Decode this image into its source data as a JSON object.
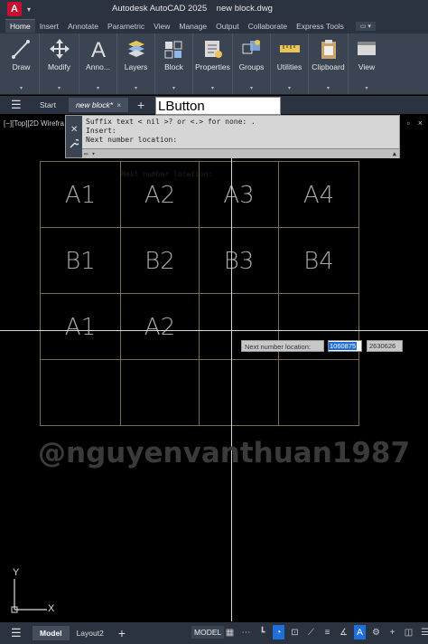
{
  "titlebar": {
    "app_icon": "A",
    "caret": "▾",
    "title": "Autodesk AutoCAD 2025    new block.dwg"
  },
  "ribbon_tabs": [
    "Home",
    "Insert",
    "Annotate",
    "Parametric",
    "View",
    "Manage",
    "Output",
    "Collaborate",
    "Express Tools"
  ],
  "ribbon_extra": "▭ ▾",
  "panels": [
    {
      "label": "Draw",
      "icon": "pencil-line-icon"
    },
    {
      "label": "Modify",
      "icon": "move-arrows-icon"
    },
    {
      "label": "Anno...",
      "icon": "text-a-icon"
    },
    {
      "label": "Layers",
      "icon": "layers-icon"
    },
    {
      "label": "Block",
      "icon": "block-icon"
    },
    {
      "label": "Properties",
      "icon": "properties-icon"
    },
    {
      "label": "Groups",
      "icon": "groups-icon"
    },
    {
      "label": "Utilities",
      "icon": "ruler-icon"
    },
    {
      "label": "Clipboard",
      "icon": "clipboard-icon"
    },
    {
      "label": "View",
      "icon": "view-icon"
    }
  ],
  "filetabs": {
    "start": "Start",
    "active": "new block*",
    "close": "×",
    "plus": "+"
  },
  "lbutton_text": "LButton",
  "viewport": {
    "label": "[−][Top][2D Wirefra",
    "controls": [
      "−",
      "▫",
      "×"
    ]
  },
  "command": {
    "history": [
      "Suffix text < nil >? or <.> for none: .",
      "Insert:",
      "Next number location:"
    ],
    "input": "Next number location:",
    "icon": "▭ ▾",
    "close": "✕",
    "wrench": "🔧",
    "scroll_up": "▲"
  },
  "grid": {
    "rows": [
      [
        "A1",
        "A2",
        "A3",
        "A4"
      ],
      [
        "B1",
        "B2",
        "B3",
        "B4"
      ],
      [
        "A1",
        "A2",
        "",
        ""
      ],
      [
        "",
        "",
        "",
        ""
      ]
    ]
  },
  "dynamic_input": {
    "label": "Next number location:",
    "x_value": "1060875",
    "y_value": "2630626"
  },
  "watermark": "@nguyenvanthuan1987",
  "ucs": {
    "x": "X",
    "y": "Y"
  },
  "statusbar": {
    "menu": "☰",
    "model_tab": "Model",
    "layout_tab": "Layout2",
    "plus": "+",
    "model_button": "MODEL",
    "icons": [
      "grid-icon",
      "snap-icon",
      "ortho-icon",
      "polar-icon",
      "osnap-icon",
      "iso-icon",
      "lineweight-icon",
      "annotation-icon",
      "workspace-icon",
      "gear-icon",
      "plus-icon",
      "isolate-icon",
      "hardware-icon",
      "customize-icon"
    ]
  },
  "colors": {
    "titlebar": "#2b3340",
    "ribbon": "#3b4453",
    "canvas": "#000000",
    "cell_border": "#7a6a52",
    "highlight": "#1e6fd9"
  }
}
